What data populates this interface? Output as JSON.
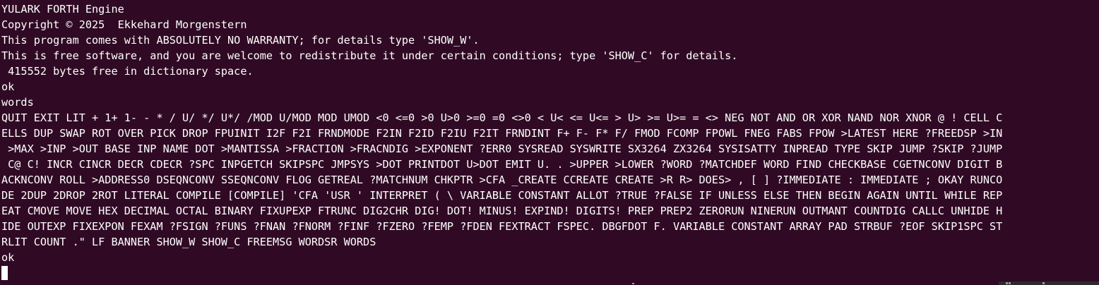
{
  "terminal": {
    "lines": [
      "YULARK FORTH Engine",
      "Copyright © 2025  Ekkehard Morgenstern",
      "This program comes with ABSOLUTELY NO WARRANTY; for details type 'SHOW_W'.",
      "This is free software, and you are welcome to redistribute it under certain conditions; type 'SHOW_C' for details.",
      " 415552 bytes free in dictionary space.",
      "ok",
      "words",
      "QUIT EXIT LIT + 1+ 1- - * / U/ */ U*/ /MOD U/MOD MOD UMOD <0 <=0 >0 U>0 >=0 =0 <>0 < U< <= U<= > U> >= U>= = <> NEG NOT AND OR XOR NAND NOR XNOR @ ! CELL C",
      "ELLS DUP SWAP ROT OVER PICK DROP FPUINIT I2F F2I FRNDMODE F2IN F2ID F2IU F2IT FRNDINT F+ F- F* F/ FMOD FCOMP FPOWL FNEG FABS FPOW >LATEST HERE ?FREEDSP >IN",
      " >MAX >INP >OUT BASE INP NAME DOT >MANTISSA >FRACTION >FRACNDIG >EXPONENT ?ERR0 SYSREAD SYSWRITE SX3264 ZX3264 SYSISATTY INPREAD TYPE SKIP JUMP ?SKIP ?JUMP",
      " C@ C! INCR CINCR DECR CDECR ?SPC INPGETCH SKIPSPC JMPSYS >DOT PRINTDOT U>DOT EMIT U. . >UPPER >LOWER ?WORD ?MATCHDEF WORD FIND CHECKBASE CGETNCONV DIGIT B",
      "ACKNCONV ROLL >ADDRESS0 DSEQNCONV SSEQNCONV FLOG GETREAL ?MATCHNUM CHKPTR >CFA _CREATE CCREATE CREATE >R R> DOES> , [ ] ?IMMEDIATE : IMMEDIATE ; OKAY RUNCO",
      "DE 2DUP 2DROP 2ROT LITERAL COMPILE [COMPILE] 'CFA 'USR ' INTERPRET ( \\ VARIABLE CONSTANT ALLOT ?TRUE ?FALSE IF UNLESS ELSE THEN BEGIN AGAIN UNTIL WHILE REP",
      "EAT CMOVE MOVE HEX DECIMAL OCTAL BINARY FIXUPEXP FTRUNC DIG2CHR DIG! DOT! MINUS! EXPIND! DIGITS! PREP PREP2 ZERORUN NINERUN OUTMANT COUNTDIG CALLC UNHIDE H",
      "IDE OUTEXP FIXEXPON FEXAM ?FSIGN ?FUNS ?FNAN ?FNORM ?FINF ?FZERO ?FEMP ?FDEN FEXTRACT FSPEC. DBGFDOT F. VARIABLE CONSTANT ARRAY PAD STRBUF ?EOF SKIP1SPC ST",
      "RLIT COUNT .\" LF BANNER SHOW_W SHOW_C FREEMSG WORDSR WORDS",
      "ok"
    ],
    "colors": {
      "background": "#300a24",
      "foreground": "#ffffff",
      "cursor": "#ffffff"
    }
  }
}
